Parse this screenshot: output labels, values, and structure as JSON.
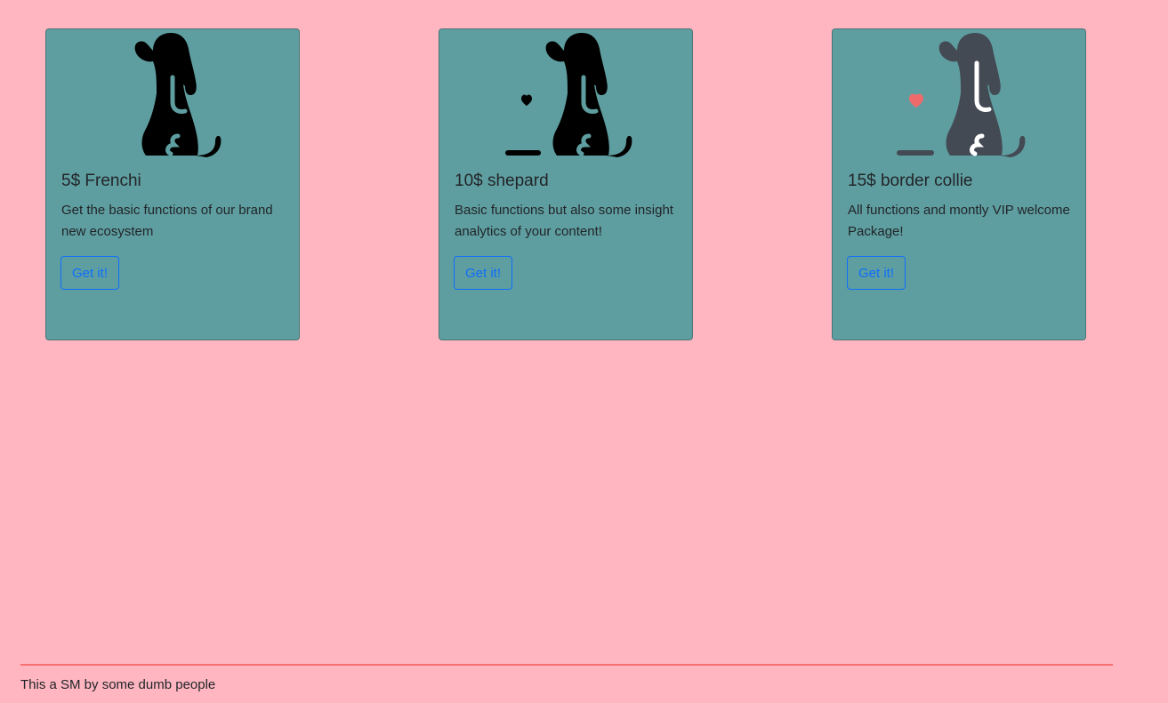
{
  "colors": {
    "background": "#ffb6c1",
    "card_background": "#5f9ea0",
    "button_accent": "#0d6efd",
    "footer_rule": "#f87171",
    "heart": "#ef6b6b",
    "dog_dark": "#000000",
    "dog_gray": "#434a54"
  },
  "cards": [
    {
      "icon": "dog-sitting-icon",
      "title": "5$ Frenchi",
      "text": "Get the basic functions of our brand new ecosystem",
      "button_label": "Get it!"
    },
    {
      "icon": "dog-with-heart-icon",
      "title": "10$ shepard",
      "text": "Basic functions but also some insight analytics of your content!",
      "button_label": "Get it!"
    },
    {
      "icon": "dog-with-heart-icon",
      "title": "15$ border collie",
      "text": "All functions and montly VIP welcome Package!",
      "button_label": "Get it!"
    }
  ],
  "footer": {
    "text": "This a SM by some dumb people"
  }
}
